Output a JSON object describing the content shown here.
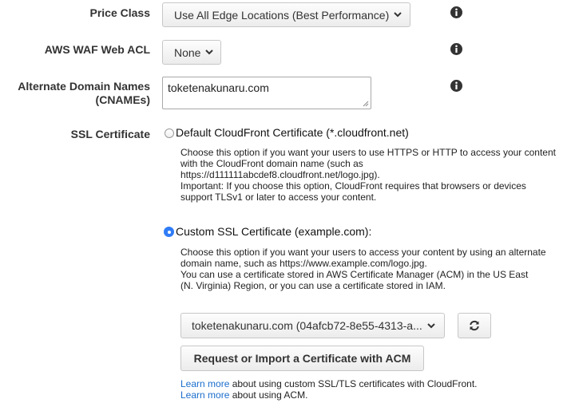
{
  "price_class": {
    "label": "Price Class",
    "value": "Use All Edge Locations (Best Performance)"
  },
  "waf": {
    "label": "AWS WAF Web ACL",
    "value": "None"
  },
  "cnames": {
    "label_line1": "Alternate Domain Names",
    "label_line2": "(CNAMEs)",
    "value": "toketenakunaru.com"
  },
  "ssl": {
    "label": "SSL Certificate",
    "default_option": {
      "label": "Default CloudFront Certificate (*.cloudfront.net)",
      "selected": false,
      "desc_lines": [
        "Choose this option if you want your users to use HTTPS or HTTP to access your content",
        "with the CloudFront domain name (such as",
        "https://d111111abcdef8.cloudfront.net/logo.jpg).",
        "Important: If you choose this option, CloudFront requires that browsers or devices",
        "support TLSv1 or later to access your content."
      ]
    },
    "custom_option": {
      "label": "Custom SSL Certificate (example.com):",
      "selected": true,
      "desc_lines": [
        "Choose this option if you want your users to access your content by using an alternate",
        "domain name, such as https://www.example.com/logo.jpg.",
        "You can use a certificate stored in AWS Certificate Manager (ACM) in the US East",
        "(N. Virginia) Region, or you can use a certificate stored in IAM."
      ]
    },
    "certificate_select": "toketenakunaru.com (04afcb72-8e55-4313-a...",
    "request_button": "Request or Import a Certificate with ACM",
    "learn1": {
      "link": "Learn more",
      "text": " about using custom SSL/TLS certificates with CloudFront."
    },
    "learn2": {
      "link": "Learn more",
      "text": " about using ACM."
    }
  },
  "icons": [
    "info-icon",
    "chevron-down-icon",
    "refresh-icon"
  ],
  "colors": {
    "link": "#1a6ecc",
    "radio_selected": "#2f7cf6"
  }
}
